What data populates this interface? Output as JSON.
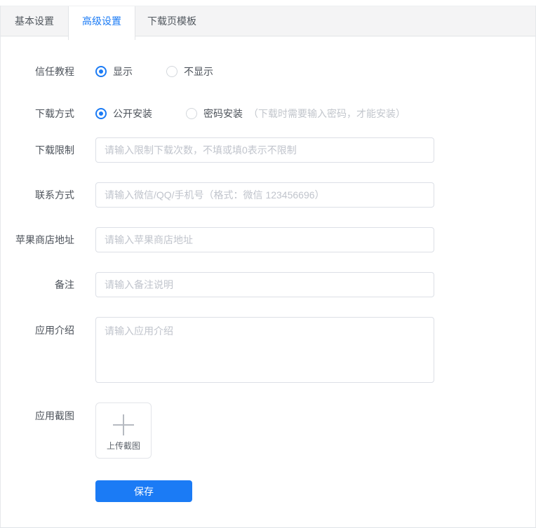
{
  "colors": {
    "accent": "#1b7bf5",
    "tabbar_bg": "#f4f4f5",
    "input_border": "#dcdfe6",
    "placeholder": "#c0c4cc"
  },
  "tabs": [
    {
      "label": "基本设置",
      "active": false
    },
    {
      "label": "高级设置",
      "active": true
    },
    {
      "label": "下载页模板",
      "active": false
    }
  ],
  "form": {
    "trust_tutorial": {
      "label": "信任教程",
      "options": [
        {
          "label": "显示",
          "selected": true
        },
        {
          "label": "不显示",
          "selected": false
        }
      ]
    },
    "download_method": {
      "label": "下载方式",
      "options": [
        {
          "label": "公开安装",
          "selected": true
        },
        {
          "label": "密码安装",
          "selected": false
        }
      ],
      "note": "（下载时需要输入密码，才能安装）"
    },
    "download_limit": {
      "label": "下载限制",
      "placeholder": "请输入限制下载次数，不填或填0表示不限制",
      "value": ""
    },
    "contact": {
      "label": "联系方式",
      "placeholder": "请输入微信/QQ/手机号（格式：微信 123456696）",
      "value": ""
    },
    "apple_store": {
      "label": "苹果商店地址",
      "placeholder": "请输入苹果商店地址",
      "value": ""
    },
    "remark": {
      "label": "备注",
      "placeholder": "请输入备注说明",
      "value": ""
    },
    "app_intro": {
      "label": "应用介绍",
      "placeholder": "请输入应用介绍",
      "value": ""
    },
    "app_screenshot": {
      "label": "应用截图",
      "upload_label": "上传截图",
      "upload_icon": "plus-icon"
    },
    "save_label": "保存"
  }
}
